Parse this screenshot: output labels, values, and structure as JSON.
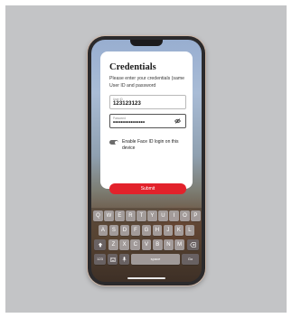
{
  "login": {
    "title": "Credentials",
    "subtitle": "Please enter your credentials (same User ID and password",
    "user_id_label": "User ID",
    "user_id_value": "123123123",
    "password_label": "Password",
    "password_value": "••••••••••••••••",
    "face_id_label": "Enable Face ID login on this device",
    "face_id_enabled": true,
    "submit_label": "Submit"
  },
  "keyboard": {
    "row1": [
      "Q",
      "W",
      "E",
      "R",
      "T",
      "Y",
      "U",
      "I",
      "O",
      "P"
    ],
    "row2": [
      "A",
      "S",
      "D",
      "F",
      "G",
      "H",
      "J",
      "K",
      "L"
    ],
    "row3": [
      "Z",
      "X",
      "C",
      "V",
      "B",
      "N",
      "M"
    ],
    "numbers_key": "123",
    "space_key": "space",
    "go_key": "Go"
  }
}
